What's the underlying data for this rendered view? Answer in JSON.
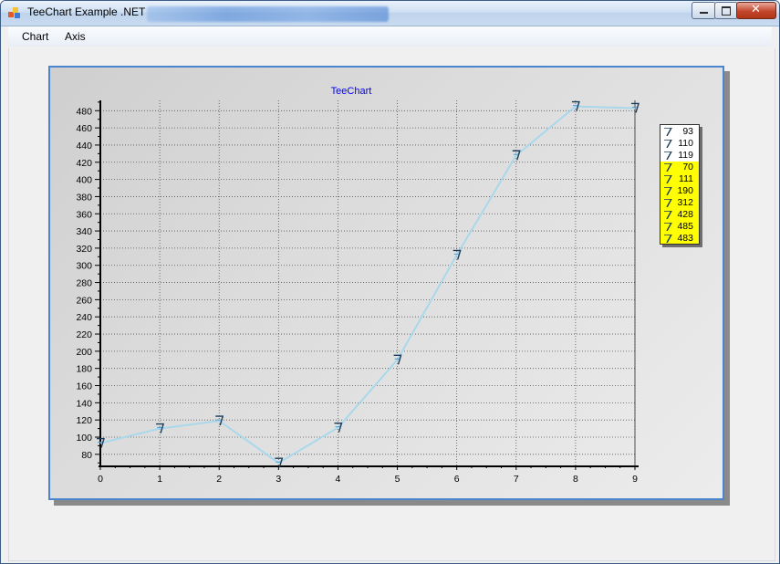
{
  "window": {
    "title": "TeeChart Example .NET"
  },
  "menu": {
    "items": [
      "Chart",
      "Axis"
    ]
  },
  "chart_data": {
    "type": "line",
    "title": "TeeChart",
    "x": [
      0,
      1,
      2,
      3,
      4,
      5,
      6,
      7,
      8,
      9
    ],
    "series": [
      {
        "values": [
          93,
          110,
          119,
          70,
          111,
          190,
          312,
          428,
          485,
          483
        ]
      }
    ],
    "xlabel": "",
    "ylabel": "",
    "xlim": [
      0,
      9
    ],
    "ylim": [
      66,
      492
    ],
    "yticks": [
      80,
      100,
      120,
      140,
      160,
      180,
      200,
      220,
      240,
      260,
      280,
      300,
      320,
      340,
      360,
      380,
      400,
      420,
      440,
      460,
      480
    ],
    "xticks": [
      0,
      1,
      2,
      3,
      4,
      5,
      6,
      7,
      8,
      9
    ],
    "grid": true,
    "legend": "right",
    "colors": {
      "line": "#a9d8ec",
      "legend_bg": "#ffff00",
      "title": "#0000ff",
      "panel_border": "#4a86d0"
    }
  }
}
